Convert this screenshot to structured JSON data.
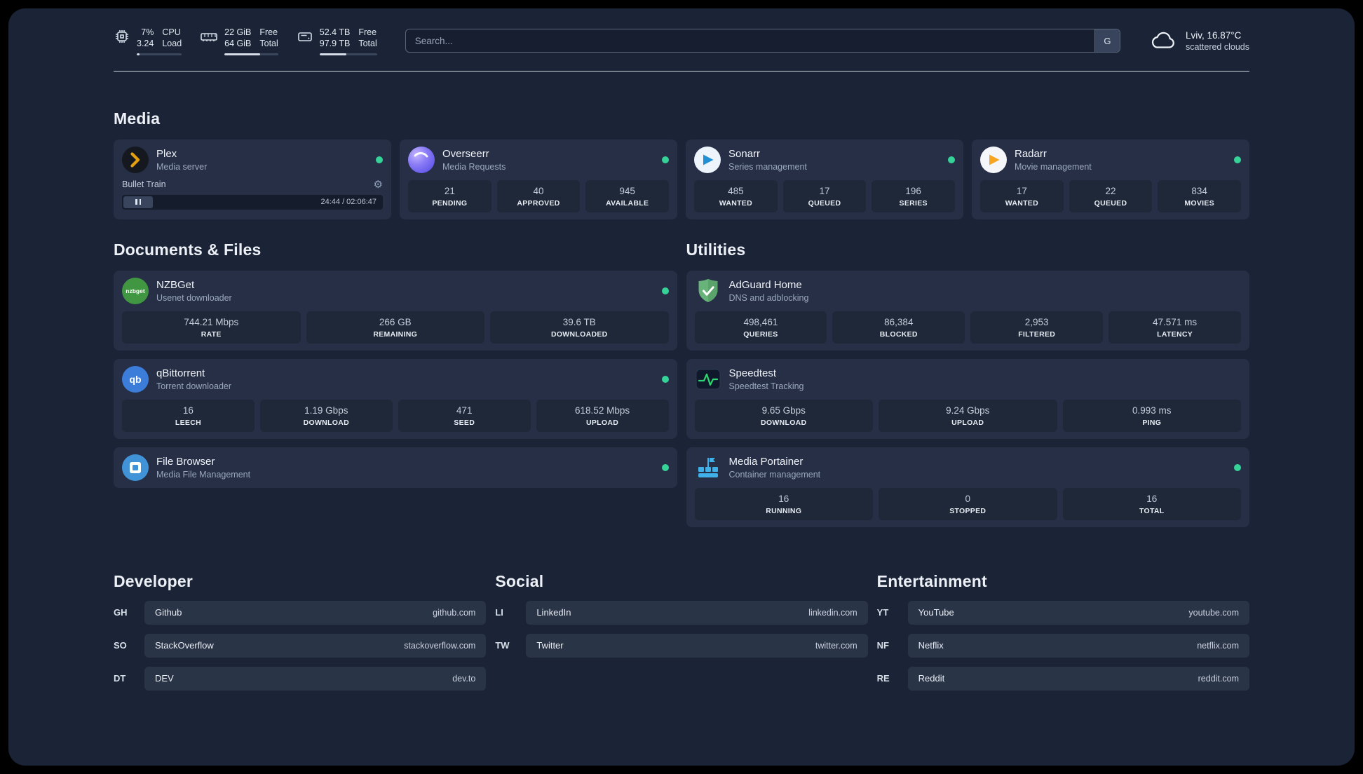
{
  "colors": {
    "status_online": "#36d399",
    "plex_amber": "#e5a00d",
    "sonarr_blue": "#1f8fd6",
    "radarr_orange": "#f7a420",
    "nzbget_green": "#419642",
    "qbittorrent_blue": "#3b7dd8",
    "filebrowser_blue": "#4193d8",
    "adguard_green": "#67b37a",
    "speedtest_green": "#2fd671",
    "portainer_blue": "#3fb0e8"
  },
  "topbar": {
    "cpu": {
      "icon": "cpu-icon",
      "value_top": "7%",
      "value_bottom": "3.24",
      "label_top": "CPU",
      "label_bottom": "Load",
      "bar_percent": 7
    },
    "memory": {
      "icon": "memory-icon",
      "value_top": "22 GiB",
      "value_bottom": "64 GiB",
      "label_top": "Free",
      "label_bottom": "Total",
      "bar_percent": 66
    },
    "disk": {
      "icon": "disk-icon",
      "value_top": "52.4 TB",
      "value_bottom": "97.9 TB",
      "label_top": "Free",
      "label_bottom": "Total",
      "bar_percent": 47
    },
    "search": {
      "placeholder": "Search...",
      "provider_button": "G"
    },
    "weather": {
      "icon": "cloud-icon",
      "location": "Lviv, 16.87°C",
      "condition": "scattered clouds"
    }
  },
  "sections": {
    "media": {
      "heading": "Media",
      "plex": {
        "icon": "plex-icon",
        "title": "Plex",
        "subtitle": "Media server",
        "player": {
          "track": "Bullet Train",
          "time": "24:44 / 02:06:47"
        }
      },
      "overseerr": {
        "icon": "overseerr-icon",
        "title": "Overseerr",
        "subtitle": "Media Requests",
        "stats": [
          {
            "value": "21",
            "label": "PENDING"
          },
          {
            "value": "40",
            "label": "APPROVED"
          },
          {
            "value": "945",
            "label": "AVAILABLE"
          }
        ]
      },
      "sonarr": {
        "icon": "sonarr-icon",
        "title": "Sonarr",
        "subtitle": "Series management",
        "stats": [
          {
            "value": "485",
            "label": "WANTED"
          },
          {
            "value": "17",
            "label": "QUEUED"
          },
          {
            "value": "196",
            "label": "SERIES"
          }
        ]
      },
      "radarr": {
        "icon": "radarr-icon",
        "title": "Radarr",
        "subtitle": "Movie management",
        "stats": [
          {
            "value": "17",
            "label": "WANTED"
          },
          {
            "value": "22",
            "label": "QUEUED"
          },
          {
            "value": "834",
            "label": "MOVIES"
          }
        ]
      }
    },
    "documents": {
      "heading": "Documents & Files",
      "nzbget": {
        "icon": "nzbget-icon",
        "icon_text": "nzbget",
        "title": "NZBGet",
        "subtitle": "Usenet downloader",
        "stats": [
          {
            "value": "744.21 Mbps",
            "label": "RATE"
          },
          {
            "value": "266 GB",
            "label": "REMAINING"
          },
          {
            "value": "39.6 TB",
            "label": "DOWNLOADED"
          }
        ]
      },
      "qbittorrent": {
        "icon": "qbittorrent-icon",
        "icon_text": "qb",
        "title": "qBittorrent",
        "subtitle": "Torrent downloader",
        "stats": [
          {
            "value": "16",
            "label": "LEECH"
          },
          {
            "value": "1.19 Gbps",
            "label": "DOWNLOAD"
          },
          {
            "value": "471",
            "label": "SEED"
          },
          {
            "value": "618.52 Mbps",
            "label": "UPLOAD"
          }
        ]
      },
      "filebrowser": {
        "icon": "filebrowser-icon",
        "title": "File Browser",
        "subtitle": "Media File Management"
      }
    },
    "utilities": {
      "heading": "Utilities",
      "adguard": {
        "icon": "adguard-icon",
        "title": "AdGuard Home",
        "subtitle": "DNS and adblocking",
        "stats": [
          {
            "value": "498,461",
            "label": "QUERIES"
          },
          {
            "value": "86,384",
            "label": "BLOCKED"
          },
          {
            "value": "2,953",
            "label": "FILTERED"
          },
          {
            "value": "47.571 ms",
            "label": "LATENCY"
          }
        ]
      },
      "speedtest": {
        "icon": "speedtest-icon",
        "title": "Speedtest",
        "subtitle": "Speedtest Tracking",
        "stats": [
          {
            "value": "9.65 Gbps",
            "label": "DOWNLOAD"
          },
          {
            "value": "9.24 Gbps",
            "label": "UPLOAD"
          },
          {
            "value": "0.993 ms",
            "label": "PING"
          }
        ]
      },
      "portainer": {
        "icon": "portainer-icon",
        "title": "Media Portainer",
        "subtitle": "Container management",
        "stats": [
          {
            "value": "16",
            "label": "RUNNING"
          },
          {
            "value": "0",
            "label": "STOPPED"
          },
          {
            "value": "16",
            "label": "TOTAL"
          }
        ]
      }
    }
  },
  "bookmarks": [
    {
      "heading": "Developer",
      "items": [
        {
          "abbr": "GH",
          "name": "Github",
          "url": "github.com"
        },
        {
          "abbr": "SO",
          "name": "StackOverflow",
          "url": "stackoverflow.com"
        },
        {
          "abbr": "DT",
          "name": "DEV",
          "url": "dev.to"
        }
      ]
    },
    {
      "heading": "Social",
      "items": [
        {
          "abbr": "LI",
          "name": "LinkedIn",
          "url": "linkedin.com"
        },
        {
          "abbr": "TW",
          "name": "Twitter",
          "url": "twitter.com"
        }
      ]
    },
    {
      "heading": "Entertainment",
      "items": [
        {
          "abbr": "YT",
          "name": "YouTube",
          "url": "youtube.com"
        },
        {
          "abbr": "NF",
          "name": "Netflix",
          "url": "netflix.com"
        },
        {
          "abbr": "RE",
          "name": "Reddit",
          "url": "reddit.com"
        }
      ]
    }
  ]
}
